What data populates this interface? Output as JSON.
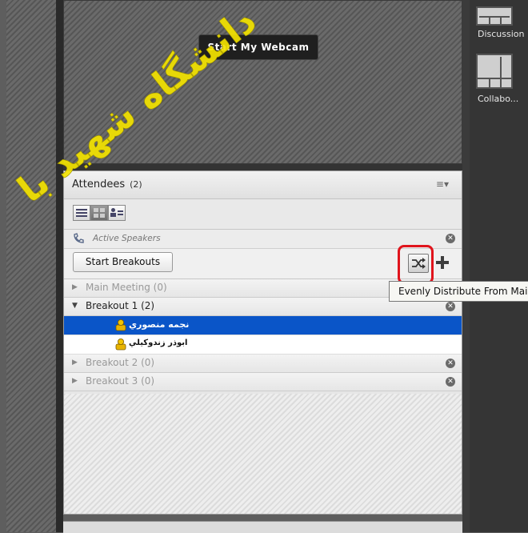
{
  "webcam": {
    "button_label": "Start My Webcam"
  },
  "layouts": [
    {
      "label": "Discussion"
    },
    {
      "label": "Collabo..."
    }
  ],
  "attendees": {
    "title": "Attendees",
    "count": "(2)",
    "menu_icon": "≡▾",
    "view_modes": [
      "list-view-icon",
      "breakout-view-icon",
      "status-view-icon"
    ],
    "active_speakers_label": "Active Speakers",
    "start_breakouts_label": "Start Breakouts",
    "groups": [
      {
        "label": "Main Meeting (0)",
        "expanded": false
      },
      {
        "label": "Breakout 1 (2)",
        "expanded": true
      },
      {
        "label": "Breakout 2 (0)",
        "expanded": false
      },
      {
        "label": "Breakout 3 (0)",
        "expanded": false
      }
    ],
    "users": [
      {
        "name": "نجمه منصوري",
        "selected": true
      },
      {
        "name": "ابوذر زندوكيلي",
        "selected": false
      }
    ]
  },
  "tooltip": {
    "text": "Evenly Distribute From Main"
  },
  "watermark": {
    "text": "دانشگاه شهید با"
  },
  "colors": {
    "selection": "#0a55c8",
    "highlight": "#e0141c",
    "watermark": "#f3e300"
  }
}
